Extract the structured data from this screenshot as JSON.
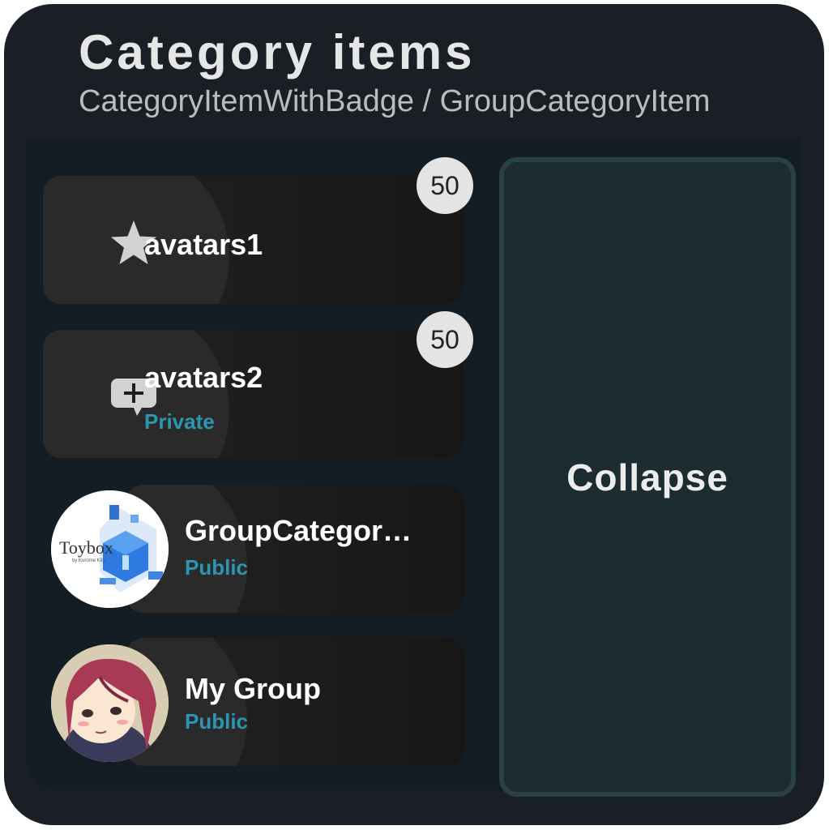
{
  "header": {
    "title": "Category items",
    "subtitle": "CategoryItemWithBadge / GroupCategoryItem"
  },
  "items": [
    {
      "title": "avatars1",
      "badge": "50",
      "icon": "star-icon"
    },
    {
      "title": "avatars2",
      "subtitle": "Private",
      "badge": "50",
      "icon": "chat-add-icon"
    }
  ],
  "groups": [
    {
      "title": "GroupCategor…",
      "subtitle": "Public",
      "logo_text": "Toybox",
      "logo_caption": "by Kurome Kits"
    },
    {
      "title": "My Group",
      "subtitle": "Public"
    }
  ],
  "collapse_label": "Collapse",
  "colors": {
    "background": "#1a1f26",
    "accent": "#2c95b1",
    "badge": "#e4e4e4",
    "collapse_bg": "#1d2c31"
  }
}
